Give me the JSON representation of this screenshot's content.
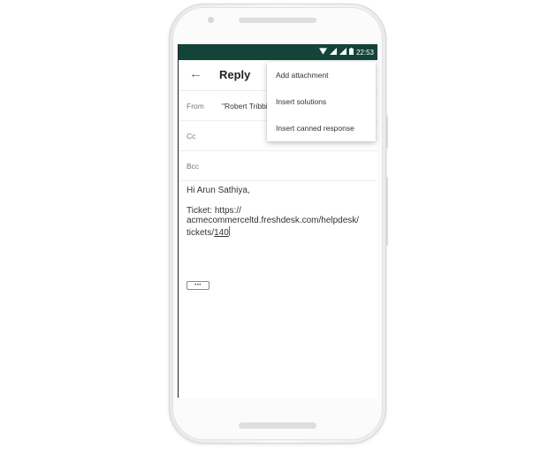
{
  "statusbar": {
    "time": "22:53",
    "wifi_icon": "wifi-icon",
    "signal_icon": "signal-icon",
    "battery_icon": "battery-icon"
  },
  "appbar": {
    "back_icon": "arrow-left-icon",
    "title": "Reply"
  },
  "fields": {
    "from_label": "From",
    "from_value": "\"Robert Tribbi",
    "cc_label": "Cc",
    "bcc_label": "Bcc"
  },
  "body": {
    "greeting": "Hi Arun Sathiya,",
    "ticket_line1": "Ticket: https://",
    "ticket_line2": "acmecommerceltd.freshdesk.com/helpdesk/",
    "ticket_line3_prefix": "tickets/",
    "ticket_number": "140",
    "ellipsis": "•••"
  },
  "menu": {
    "items": [
      {
        "label": "Add attachment"
      },
      {
        "label": "Insert solutions"
      },
      {
        "label": "Insert canned response"
      }
    ]
  },
  "colors": {
    "statusbar": "#13443a",
    "accent": "#1f8f78"
  }
}
